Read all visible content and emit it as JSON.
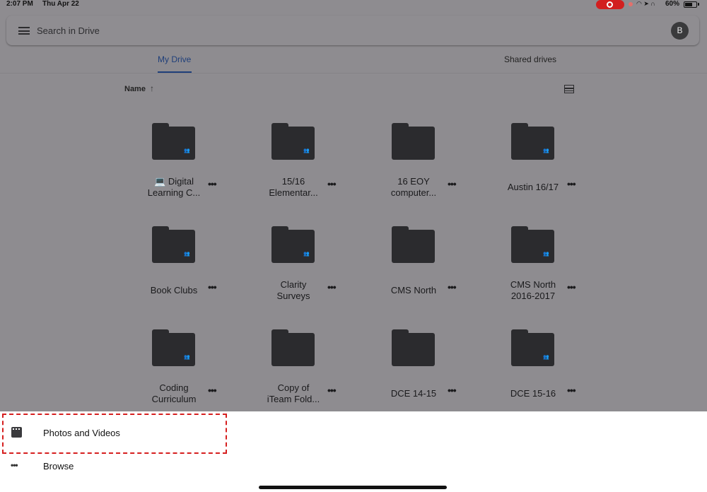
{
  "status_bar": {
    "time": "2:07 PM",
    "date": "Thu Apr 22",
    "battery": "60%",
    "icons": [
      "screen-record-icon",
      "wifi-icon",
      "location-icon",
      "headphones-icon",
      "battery-icon"
    ]
  },
  "search": {
    "placeholder": "Search in Drive",
    "menu_icon": "hamburger-icon",
    "avatar_initial": "B"
  },
  "tabs": [
    {
      "label": "My Drive",
      "active": true
    },
    {
      "label": "Shared drives",
      "active": false
    }
  ],
  "sort": {
    "label": "Name",
    "direction_icon": "arrow-up-icon",
    "view_toggle_icon": "list-view-icon"
  },
  "folders": [
    {
      "line1": "💻 Digital",
      "line2": "Learning C...",
      "shared": true
    },
    {
      "line1": "15/16",
      "line2": "Elementar...",
      "shared": true
    },
    {
      "line1": "16 EOY",
      "line2": "computer...",
      "shared": false
    },
    {
      "line1": "Austin 16/17",
      "line2": "",
      "shared": true
    },
    {
      "line1": "Book Clubs",
      "line2": "",
      "shared": true
    },
    {
      "line1": "Clarity",
      "line2": "Surveys",
      "shared": true
    },
    {
      "line1": "CMS North",
      "line2": "",
      "shared": false
    },
    {
      "line1": "CMS North",
      "line2": "2016-2017",
      "shared": true
    },
    {
      "line1": "Coding",
      "line2": "Curriculum",
      "shared": true
    },
    {
      "line1": "Copy of",
      "line2": "iTeam Fold...",
      "shared": false
    },
    {
      "line1": "DCE 14-15",
      "line2": "",
      "shared": false
    },
    {
      "line1": "DCE 15-16",
      "line2": "",
      "shared": true
    }
  ],
  "more_label": "•••",
  "bottom_sheet": {
    "items": [
      {
        "label": "Photos and Videos",
        "icon": "photos-videos-icon"
      },
      {
        "label": "Browse",
        "icon": "more-horizontal-icon"
      }
    ]
  },
  "colors": {
    "accent": "#1f3f7a",
    "highlight": "#d61f1f",
    "folder": "#2b2b2e"
  }
}
